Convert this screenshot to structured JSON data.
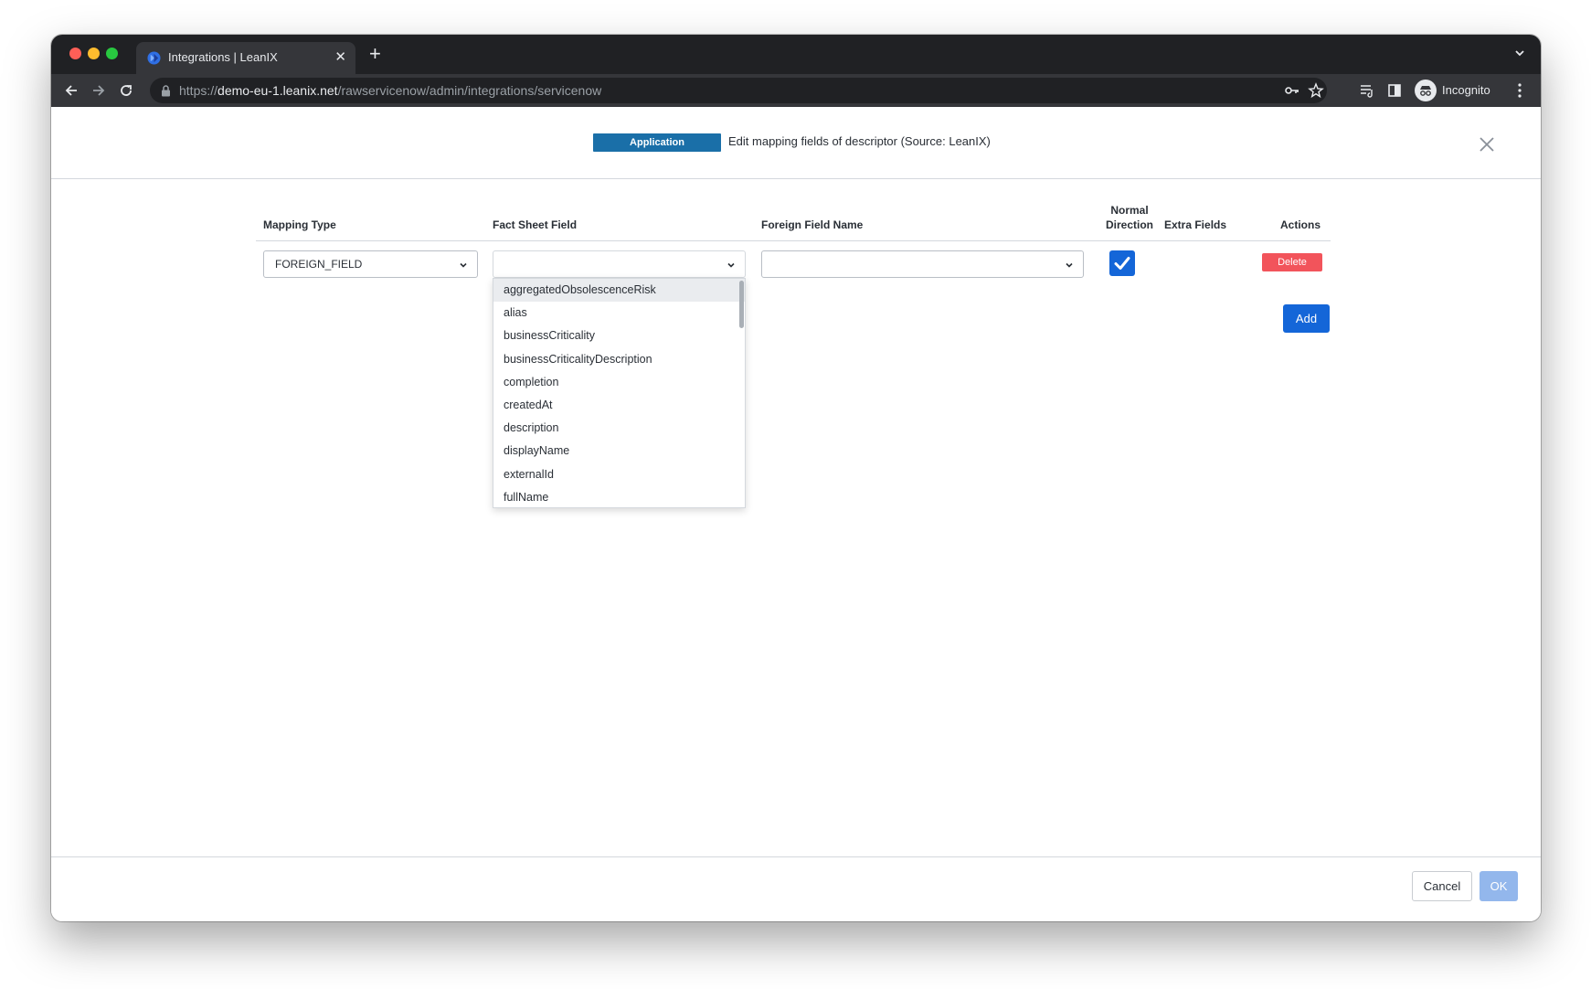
{
  "browser": {
    "tab_title": "Integrations | LeanIX",
    "tab_close": "✕",
    "new_tab": "+",
    "url_scheme": "https://",
    "url_host": "demo-eu-1.leanix.net",
    "url_path": "/rawservicenow/admin/integrations/servicenow",
    "profile_label": "Incognito"
  },
  "dialog": {
    "badge": "Application",
    "header_text": "Edit mapping fields of descriptor (Source: LeanIX)"
  },
  "table": {
    "headers": {
      "mapping_type": "Mapping Type",
      "fact_sheet_field": "Fact Sheet Field",
      "foreign_field_name": "Foreign Field Name",
      "normal_direction_1": "Normal",
      "normal_direction_2": "Direction",
      "extra_fields": "Extra Fields",
      "actions": "Actions"
    },
    "row": {
      "mapping_type_value": "FOREIGN_FIELD",
      "fact_sheet_field_value": "",
      "foreign_field_value": "",
      "normal_direction_checked": true,
      "delete_label": "Delete"
    },
    "add_label": "Add"
  },
  "dropdown": {
    "options": [
      "aggregatedObsolescenceRisk",
      "alias",
      "businessCriticality",
      "businessCriticalityDescription",
      "completion",
      "createdAt",
      "description",
      "displayName",
      "externalId",
      "fullName"
    ],
    "highlighted_index": 0
  },
  "footer": {
    "cancel_label": "Cancel",
    "ok_label": "OK"
  },
  "colors": {
    "badge": "#1a6fa8",
    "primary": "#1466d8",
    "danger": "#f2545b",
    "ok_disabled": "#93b7ec"
  }
}
